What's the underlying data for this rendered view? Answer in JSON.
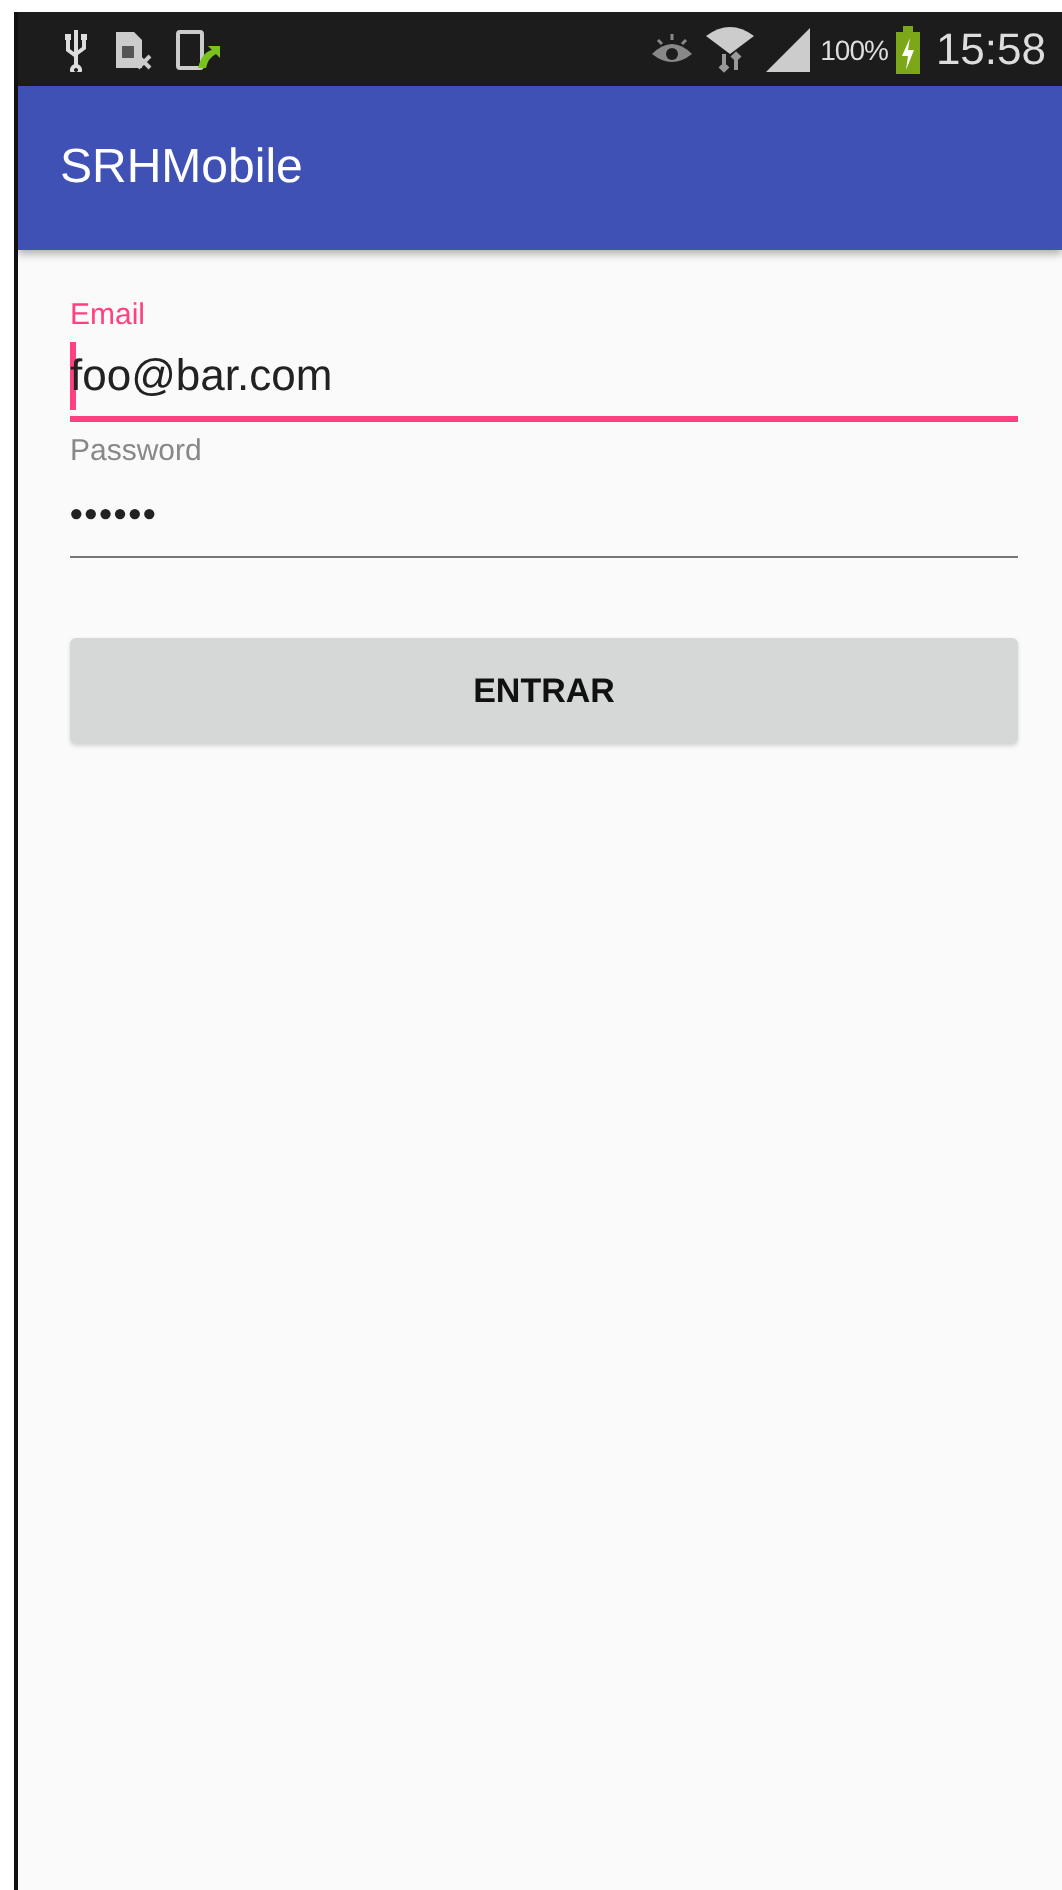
{
  "status_bar": {
    "battery": "100%",
    "time": "15:58"
  },
  "app_bar": {
    "title": "SRHMobile"
  },
  "fields": [
    {
      "label": "Email",
      "value": "foo@bar.com",
      "focused": true
    },
    {
      "label": "Password",
      "value": "••••••",
      "focused": false
    }
  ],
  "button": {
    "label": "ENTRAR"
  }
}
